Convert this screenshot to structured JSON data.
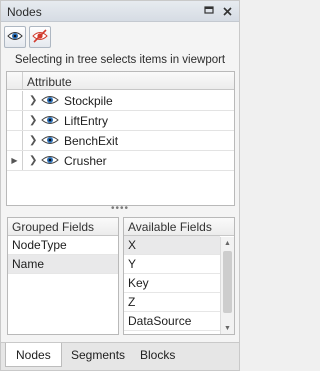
{
  "panel": {
    "title": "Nodes"
  },
  "toolbar": {
    "show_all_icon": "eye-icon",
    "hide_all_icon": "eye-hidden-icon"
  },
  "hint_text": "Selecting in tree selects items in viewport",
  "tree": {
    "column_header": "Attribute",
    "rows": [
      {
        "label": "Stockpile"
      },
      {
        "label": "LiftEntry"
      },
      {
        "label": "BenchExit"
      },
      {
        "label": "Crusher"
      }
    ]
  },
  "splitter_glyph": "••••",
  "grouped_fields": {
    "header": "Grouped Fields",
    "items": [
      "NodeType",
      "Name"
    ]
  },
  "available_fields": {
    "header": "Available Fields",
    "items": [
      "X",
      "Y",
      "Key",
      "Z",
      "DataSource"
    ]
  },
  "tabs": [
    "Nodes",
    "Segments",
    "Blocks"
  ],
  "colors": {
    "eye_accent": "#2a6fb8",
    "hidden_accent": "#d23b2e"
  }
}
